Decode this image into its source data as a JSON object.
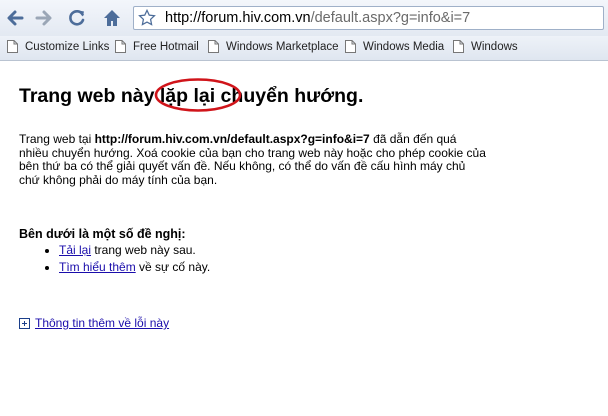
{
  "browser": {
    "url_host": "http://forum.hiv.com.vn",
    "url_path": "/default.aspx?g=info&i=7"
  },
  "bookmarks": [
    {
      "label": "Customize Links"
    },
    {
      "label": "Free Hotmail"
    },
    {
      "label": "Windows Marketplace"
    },
    {
      "label": "Windows Media"
    },
    {
      "label": "Windows"
    }
  ],
  "page": {
    "heading": "Trang web này lặp lại chuyển hướng.",
    "para_prefix": "Trang web tại ",
    "para_url": "http://forum.hiv.com.vn/default.aspx?g=info&i=7",
    "para_rest": " đã dẫn đến quá nhiều chuyển hướng. Xoá cookie của bạn cho trang web này hoặc cho phép cookie của bên thứ ba có thể giải quyết vấn đề. Nếu không, có thể do vấn đề cấu hình máy chủ chứ không phải do máy tính của bạn.",
    "suggest_heading": "Bên dưới là một số đề nghị:",
    "reload_link": "Tải lại",
    "reload_rest": " trang web này sau.",
    "learn_link": "Tìm hiểu thêm",
    "learn_rest": " về sự cố này.",
    "more_info_link": "Thông tin thêm về lỗi này"
  },
  "colors": {
    "link": "#1a0dab",
    "annotation_ring": "#d0141a"
  }
}
